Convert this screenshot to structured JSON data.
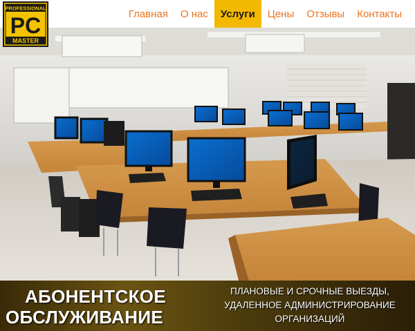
{
  "logo": {
    "line1": "PROFESSIONAL",
    "line2": "PC",
    "line3": "MASTER"
  },
  "nav": {
    "items": [
      {
        "label": "Главная"
      },
      {
        "label": "О нас"
      },
      {
        "label": "Услуги",
        "active": true
      },
      {
        "label": "Цены"
      },
      {
        "label": "Отзывы"
      },
      {
        "label": "Контакты"
      }
    ]
  },
  "banner": {
    "title_line1": "АБОНЕНТСКОЕ",
    "title_line2": "ОБСЛУЖИВАНИЕ",
    "subtitle_line1": "ПЛАНОВЫЕ И СРОЧНЫЕ ВЫЕЗДЫ,",
    "subtitle_line2": "УДАЛЕННОЕ АДМИНИСТРИРОВАНИЕ",
    "subtitle_line3": "ОРГАНИЗАЦИЙ"
  },
  "colors": {
    "accent": "#e9731f",
    "active_bg": "#f3b900",
    "logo_bg": "#f3c300"
  }
}
